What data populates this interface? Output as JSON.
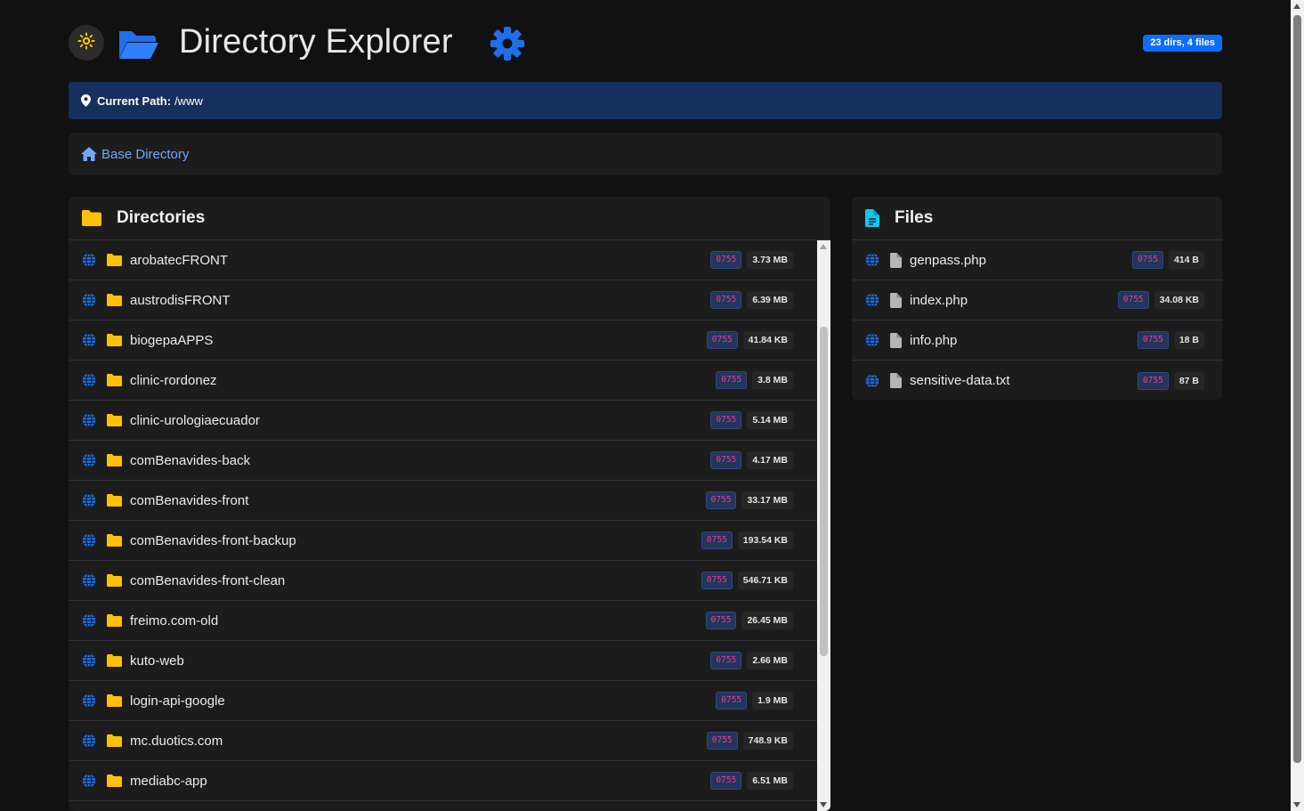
{
  "header": {
    "title": "Directory Explorer",
    "count_badge": "23 dirs, 4 files",
    "theme_toggle_icon": "sun-icon",
    "folder_icon": "folder-open-icon",
    "settings_icon": "gear-icon"
  },
  "path": {
    "label": "Current Path:",
    "value": "/www"
  },
  "breadcrumb": {
    "home_label": "Base Directory"
  },
  "directories": {
    "title": "Directories",
    "items": [
      {
        "name": "arobatecFRONT",
        "perm": "0755",
        "size": "3.73 MB"
      },
      {
        "name": "austrodisFRONT",
        "perm": "0755",
        "size": "6.39 MB"
      },
      {
        "name": "biogepaAPPS",
        "perm": "0755",
        "size": "41.84 KB"
      },
      {
        "name": "clinic-rordonez",
        "perm": "0755",
        "size": "3.8 MB"
      },
      {
        "name": "clinic-urologiaecuador",
        "perm": "0755",
        "size": "5.14 MB"
      },
      {
        "name": "comBenavides-back",
        "perm": "0755",
        "size": "4.17 MB"
      },
      {
        "name": "comBenavides-front",
        "perm": "0755",
        "size": "33.17 MB"
      },
      {
        "name": "comBenavides-front-backup",
        "perm": "0755",
        "size": "193.54 KB"
      },
      {
        "name": "comBenavides-front-clean",
        "perm": "0755",
        "size": "546.71 KB"
      },
      {
        "name": "freimo.com-old",
        "perm": "0755",
        "size": "26.45 MB"
      },
      {
        "name": "kuto-web",
        "perm": "0755",
        "size": "2.66 MB"
      },
      {
        "name": "login-api-google",
        "perm": "0755",
        "size": "1.9 MB"
      },
      {
        "name": "mc.duotics.com",
        "perm": "0755",
        "size": "748.9 KB"
      },
      {
        "name": "mediabc-app",
        "perm": "0755",
        "size": "6.51 MB"
      }
    ]
  },
  "files": {
    "title": "Files",
    "items": [
      {
        "name": "genpass.php",
        "perm": "0755",
        "size": "414 B"
      },
      {
        "name": "index.php",
        "perm": "0755",
        "size": "34.08 KB"
      },
      {
        "name": "info.php",
        "perm": "0755",
        "size": "18 B"
      },
      {
        "name": "sensitive-data.txt",
        "perm": "0755",
        "size": "87 B"
      }
    ]
  },
  "colors": {
    "accent": "#0d6efd",
    "folder": "#ffc107",
    "path_bar": "#15305c",
    "perm_text": "#e83e8c",
    "file_icon": "#0dcaf0"
  }
}
